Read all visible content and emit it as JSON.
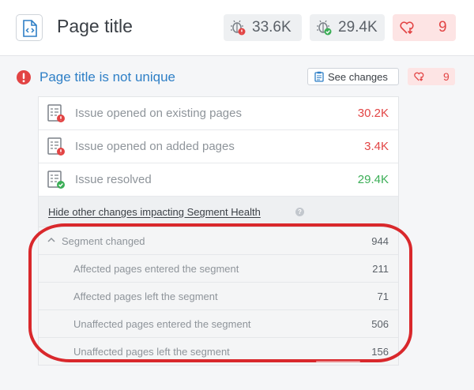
{
  "header": {
    "title": "Page title",
    "stats": [
      {
        "icon": "bug-alert-icon",
        "value": "33.6K"
      },
      {
        "icon": "bug-check-icon",
        "value": "29.4K"
      },
      {
        "icon": "heart-down-icon",
        "value": "9"
      }
    ]
  },
  "issue": {
    "title": "Page title is not unique",
    "see_changes_label": "See changes",
    "badge_value": "9"
  },
  "changes": [
    {
      "label": "Issue opened on existing pages",
      "value": "30.2K",
      "status": "red"
    },
    {
      "label": "Issue opened on added pages",
      "value": "3.4K",
      "status": "red"
    },
    {
      "label": "Issue resolved",
      "value": "29.4K",
      "status": "green"
    }
  ],
  "hide_link": "Hide other changes impacting Segment Health",
  "segment": {
    "header": {
      "label": "Segment changed",
      "value": "944"
    },
    "rows": [
      {
        "label": "Affected pages entered the segment",
        "value": "211"
      },
      {
        "label": "Affected pages left the segment",
        "value": "71"
      },
      {
        "label": "Unaffected pages entered the segment",
        "value": "506"
      },
      {
        "label": "Unaffected pages left the segment",
        "value": "156"
      }
    ]
  },
  "colors": {
    "link_blue": "#2e7fc6",
    "alert_red": "#e24444",
    "success_green": "#3cae57",
    "highlight_red": "#d9282c"
  }
}
